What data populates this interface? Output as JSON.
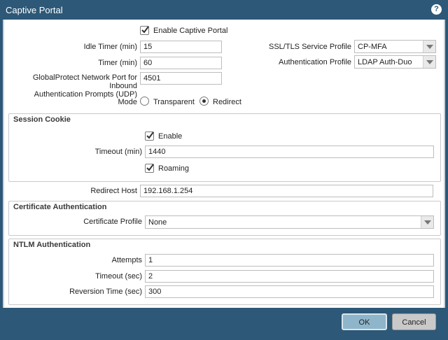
{
  "dialog": {
    "title": "Captive Portal"
  },
  "enable_captive_portal": {
    "label": "Enable Captive Portal",
    "checked": true
  },
  "idle_timer": {
    "label": "Idle Timer (min)",
    "value": "15"
  },
  "timer": {
    "label": "Timer (min)",
    "value": "60"
  },
  "gp_port": {
    "label_line1": "GlobalProtect Network Port for Inbound",
    "label_line2": "Authentication Prompts (UDP)",
    "value": "4501"
  },
  "ssl_tls": {
    "label": "SSL/TLS Service Profile",
    "value": "CP-MFA"
  },
  "auth_profile": {
    "label": "Authentication Profile",
    "value": "LDAP Auth-Duo"
  },
  "mode": {
    "label": "Mode",
    "options": [
      "Transparent",
      "Redirect"
    ],
    "selected": "Redirect"
  },
  "session_cookie": {
    "title": "Session Cookie",
    "enable_label": "Enable",
    "timeout_label": "Timeout (min)",
    "timeout_value": "1440",
    "roaming_label": "Roaming"
  },
  "redirect_host": {
    "label": "Redirect Host",
    "value": "192.168.1.254"
  },
  "cert_auth": {
    "title": "Certificate Authentication",
    "profile_label": "Certificate Profile",
    "profile_value": "None"
  },
  "ntlm": {
    "title": "NTLM Authentication",
    "attempts_label": "Attempts",
    "attempts_value": "1",
    "timeout_label": "Timeout (sec)",
    "timeout_value": "2",
    "reversion_label": "Reversion Time (sec)",
    "reversion_value": "300"
  },
  "buttons": {
    "ok": "OK",
    "cancel": "Cancel"
  }
}
